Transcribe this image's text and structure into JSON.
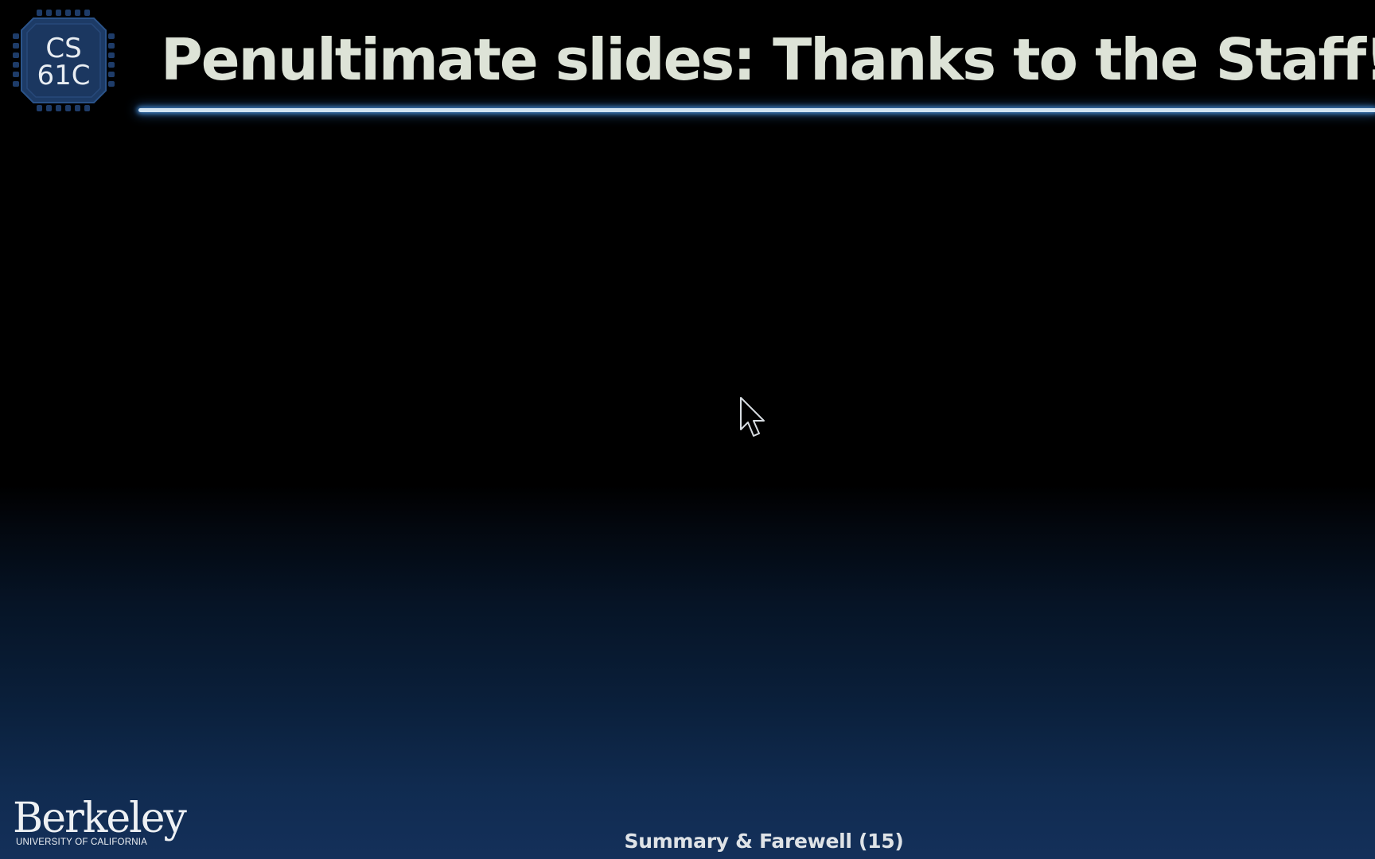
{
  "slide": {
    "title": "Penultimate slides: Thanks to the Staff!",
    "footer": "Summary & Farewell (15)"
  },
  "course_logo": {
    "line1": "CS",
    "line2": "61C",
    "icon": "cs61c-chip-logo-icon",
    "color": "#1d3b66"
  },
  "university_logo": {
    "name": "Berkeley",
    "subtitle": "UNIVERSITY OF CALIFORNIA"
  },
  "cursor": {
    "icon": "mouse-pointer-icon"
  },
  "colors": {
    "background_top": "#000000",
    "background_bottom": "#14305a",
    "title_text": "#dde3d7",
    "rule_glow": "#3f7fc2"
  }
}
